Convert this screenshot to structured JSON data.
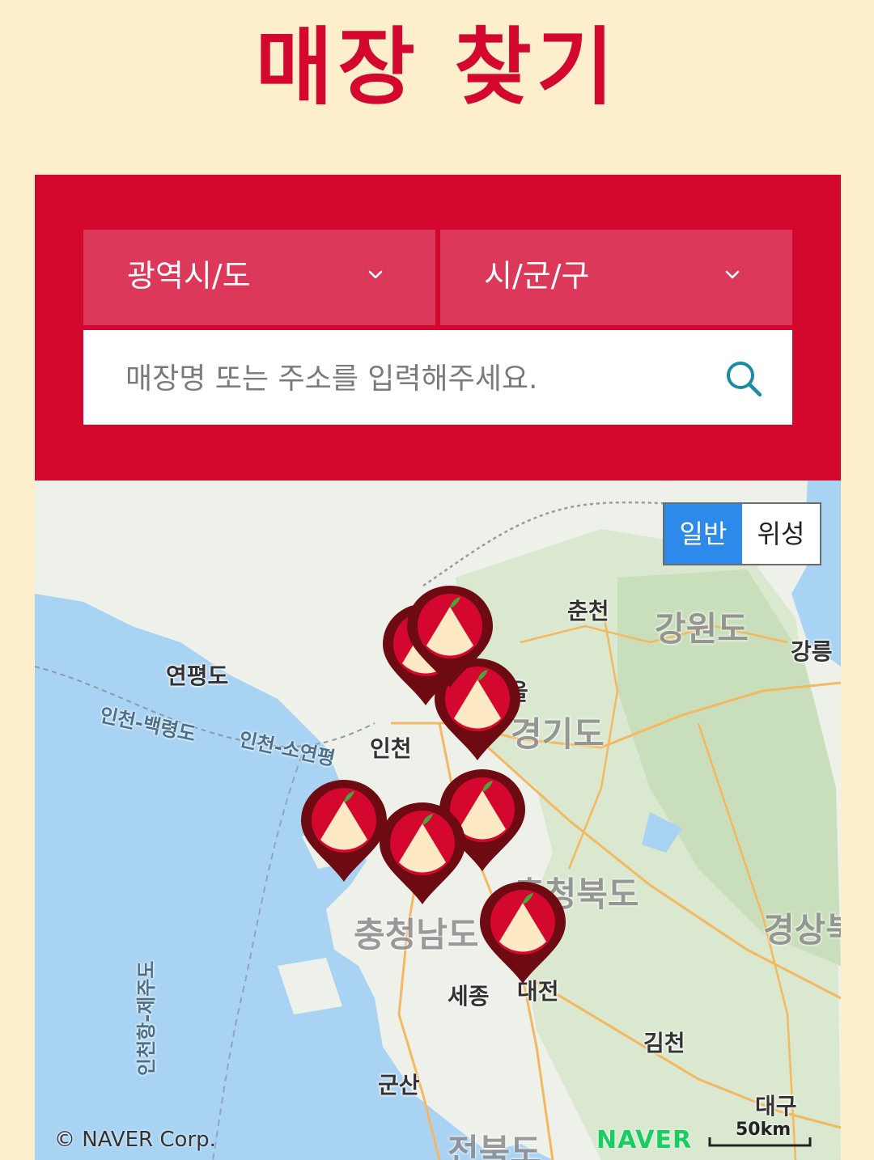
{
  "header": {
    "title": "매장 찾기"
  },
  "filters": {
    "region_label": "광역시/도",
    "district_label": "시/군/구",
    "search_placeholder": "매장명 또는 주소를 입력해주세요."
  },
  "map": {
    "toggle": {
      "normal_label": "일반",
      "satellite_label": "위성",
      "selected": "일반"
    },
    "places": {
      "chuncheon": "춘천",
      "gangwon": "강원도",
      "gangneung": "강릉",
      "yeonpyeong": "연평도",
      "incheon_baengnyeong": "인천-백령도",
      "incheon_soyeonpyeong": "인천-소연평",
      "incheon": "인천",
      "gyeonggi": "경기도",
      "chungbuk": "충청북도",
      "chungnam": "충청남도",
      "gyeongsang": "경상북",
      "sejong": "세종",
      "daejeon": "대전",
      "gimcheon": "김천",
      "gunsan": "군산",
      "jeonbuk": "전북도",
      "daegu": "대구",
      "incheon_jeju": "인천항-제주도",
      "seoul_partial": "울"
    },
    "copyright": "© NAVER Corp.",
    "logo": "NAVER",
    "scale": "50km",
    "colors": {
      "pin_outer": "#6e0a12",
      "pin_inner": "#d4082f",
      "accent": "#d4082f",
      "toggle_active": "#2d8aea"
    }
  }
}
